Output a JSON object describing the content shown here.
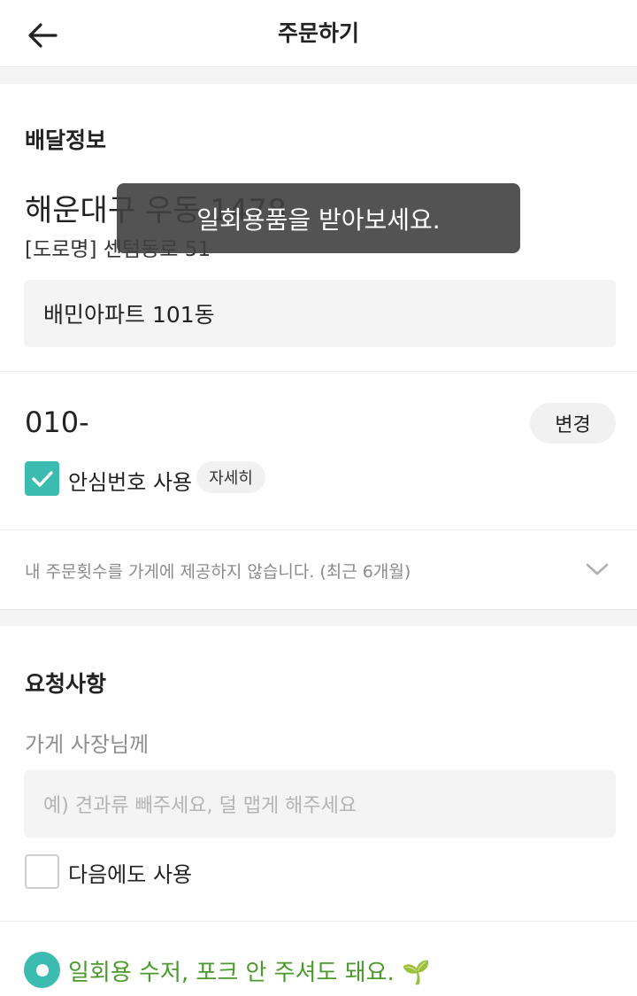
{
  "header": {
    "title": "주문하기",
    "back_icon": "arrow-left-icon"
  },
  "delivery": {
    "title": "배달정보",
    "address_main": "해운대구 우동 1478",
    "address_road": "[도로명] 센텀동로 51",
    "detail_address": "배민아파트 101동",
    "phone": "010-",
    "change_label": "변경",
    "safe_number_label": "안심번호 사용",
    "safe_number_checked": true,
    "detail_chip": "자세히",
    "order_count_notice": "내 주문횟수를 가게에 제공하지 않습니다. (최근 6개월)"
  },
  "request": {
    "title": "요청사항",
    "owner_label": "가게 사장님께",
    "owner_placeholder": "예) 견과류 빼주세요, 덜 맵게 해주세요",
    "reuse_label": "다음에도 사용",
    "reuse_checked": false,
    "eco_option": "일회용 수저, 포크 안 주셔도 돼요. 🌱"
  },
  "toast": {
    "message": "일회용품을 받아보세요."
  },
  "colors": {
    "accent": "#3cbcb0",
    "eco_green": "#4a9a2c"
  }
}
